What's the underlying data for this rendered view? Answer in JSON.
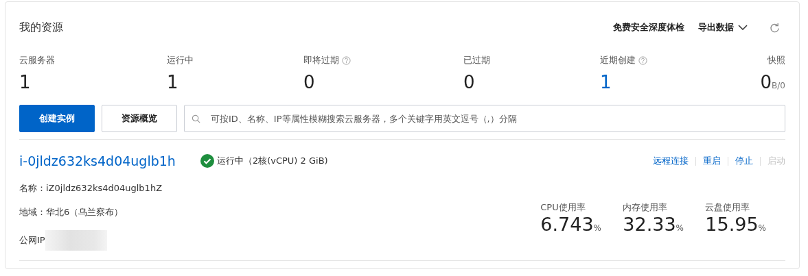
{
  "title": "我的资源",
  "header_actions": [
    {
      "label": "免费安全深度体检",
      "kind": "link"
    },
    {
      "label": "导出数据",
      "kind": "dropdown"
    },
    {
      "kind": "refresh"
    }
  ],
  "stats": [
    {
      "label": "云服务器",
      "value": "1",
      "help": false,
      "highlight": false
    },
    {
      "label": "运行中",
      "value": "1",
      "help": false,
      "highlight": false
    },
    {
      "label": "即将过期",
      "value": "0",
      "help": true,
      "highlight": false
    },
    {
      "label": "已过期",
      "value": "0",
      "help": false,
      "highlight": false
    },
    {
      "label": "近期创建",
      "value": "1",
      "help": true,
      "highlight": true
    },
    {
      "label": "快照",
      "value": "0",
      "suffix": "B/0",
      "help": false,
      "highlight": false
    }
  ],
  "buttons": [
    {
      "label": "创建实例",
      "primary": true
    },
    {
      "label": "资源概览",
      "primary": false
    }
  ],
  "search": {
    "placeholder": "可按ID、名称、IP等属性模糊搜索云服务器，多个关键字用英文逗号（,）分隔"
  },
  "instance": {
    "id": "i-0jldz632ks4d04uglb1h",
    "status": "运行中",
    "spec": "（2核(vCPU) 2 GiB)",
    "name": "名称：iZ0jldz632ks4d04uglb1hZ",
    "region": "地域：华北6（乌兰察布）",
    "ip_label": "公网IP",
    "actions": [
      {
        "label": "远程连接",
        "disabled": false
      },
      {
        "label": "重启",
        "disabled": false
      },
      {
        "label": "停止",
        "disabled": false
      },
      {
        "label": "启动",
        "disabled": true
      }
    ],
    "metrics": [
      {
        "label": "CPU使用率",
        "value": "6.743",
        "unit": "%"
      },
      {
        "label": "内存使用率",
        "value": "32.33",
        "unit": "%"
      },
      {
        "label": "云盘使用率",
        "value": "15.95",
        "unit": "%"
      }
    ]
  }
}
